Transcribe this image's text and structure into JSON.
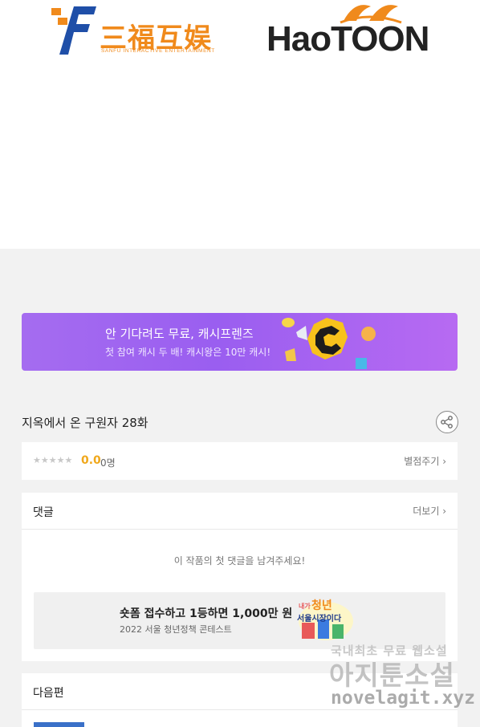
{
  "logos": {
    "sanfu_cn": "三福互娱",
    "sanfu_en": "SANFU INTERACTIVE ENTERTAINMENT",
    "haotoon": "HaoTOON"
  },
  "banner": {
    "line1": "안 기다려도 무료, 캐시프렌즈",
    "line2": "첫 참여 캐시 두 배! 캐시왕은 10만 캐시!",
    "color_start": "#a56cf0",
    "color_end": "#b76af2"
  },
  "episode": {
    "title": "지옥에서 온 구원자 28화"
  },
  "rating": {
    "stars": "★★★★★",
    "score": "0.0",
    "count": "0명",
    "rate_link": "별점주기 ›"
  },
  "comments": {
    "title": "댓글",
    "more": "더보기 ›",
    "empty": "이 작품의 첫 댓글을 남겨주세요!"
  },
  "promo": {
    "line1": "숏폼 접수하고 1등하면 1,000만 원",
    "line2": "2022 서울 청년정책 콘테스트",
    "poster_line1": "청년",
    "poster_line2": "서울시장이다",
    "poster_small": "내가"
  },
  "next": {
    "title": "다음편"
  },
  "watermark": {
    "line1": "국내최초 무료 웹소설",
    "line2": "아지툰소설",
    "line3": "novelagit.xyz"
  },
  "colors": {
    "accent_orange": "#f08a1c",
    "score_color": "#f0a81c",
    "background": "#f2f2f2"
  }
}
